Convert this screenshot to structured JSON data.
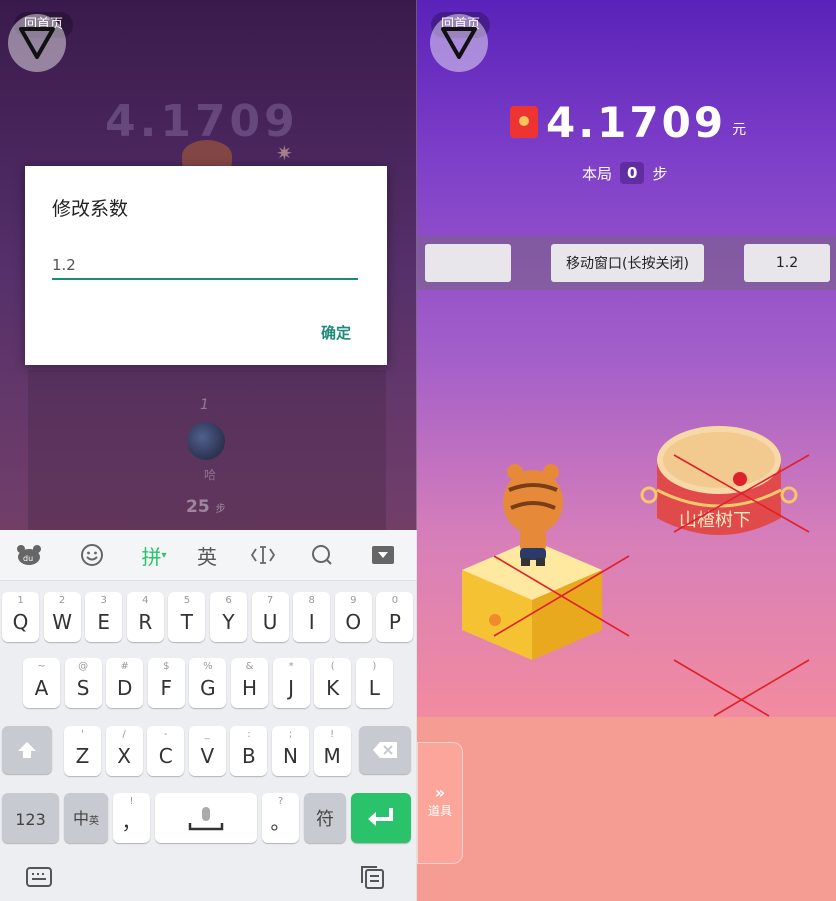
{
  "left_panel": {
    "back_label": "回首页",
    "ghost_balance": "4.1709",
    "ghost_step_number": "1",
    "ghost_player_name": "哈",
    "ghost_steps_value": "25",
    "ghost_steps_unit": "步",
    "dialog": {
      "title": "修改系数",
      "input_value": "1.2",
      "confirm_label": "确定"
    },
    "keyboard": {
      "toolbar": {
        "pinyin_label": "拼",
        "english_label": "英"
      },
      "row1": [
        {
          "main": "Q",
          "sub": "1"
        },
        {
          "main": "W",
          "sub": "2"
        },
        {
          "main": "E",
          "sub": "3"
        },
        {
          "main": "R",
          "sub": "4"
        },
        {
          "main": "T",
          "sub": "5"
        },
        {
          "main": "Y",
          "sub": "6"
        },
        {
          "main": "U",
          "sub": "7"
        },
        {
          "main": "I",
          "sub": "8"
        },
        {
          "main": "O",
          "sub": "9"
        },
        {
          "main": "P",
          "sub": "0"
        }
      ],
      "row2": [
        {
          "main": "A",
          "sub": "~"
        },
        {
          "main": "S",
          "sub": "@"
        },
        {
          "main": "D",
          "sub": "#"
        },
        {
          "main": "F",
          "sub": "$"
        },
        {
          "main": "G",
          "sub": "%"
        },
        {
          "main": "H",
          "sub": "&"
        },
        {
          "main": "J",
          "sub": "*"
        },
        {
          "main": "K",
          "sub": "("
        },
        {
          "main": "L",
          "sub": ")"
        }
      ],
      "row3": [
        {
          "main": "Z",
          "sub": "'"
        },
        {
          "main": "X",
          "sub": "/"
        },
        {
          "main": "C",
          "sub": "-"
        },
        {
          "main": "V",
          "sub": "_"
        },
        {
          "main": "B",
          "sub": ":"
        },
        {
          "main": "N",
          "sub": ";"
        },
        {
          "main": "M",
          "sub": "!"
        }
      ],
      "key_123": "123",
      "key_zh": "中",
      "key_zh_sub": "英",
      "key_comma": "，",
      "key_comma_sub": "!",
      "key_period": "。",
      "key_period_sub": "?",
      "key_symbol": "符"
    }
  },
  "right_panel": {
    "back_label": "回首页",
    "balance": "4.1709",
    "balance_unit": "元",
    "step_prefix": "本局",
    "step_value": "0",
    "step_suffix": "步",
    "controls": {
      "left_blank": "",
      "move_window": "移动窗口(长按关闭)",
      "coefficient": "1.2"
    },
    "prop_tab_label": "道具",
    "prop_tab_arrow": "»",
    "drum_text": "山楂树下"
  },
  "colors": {
    "accent_teal": "#1f8a7a",
    "enter_green": "#2ac26a",
    "cross_red": "#e0202a"
  }
}
